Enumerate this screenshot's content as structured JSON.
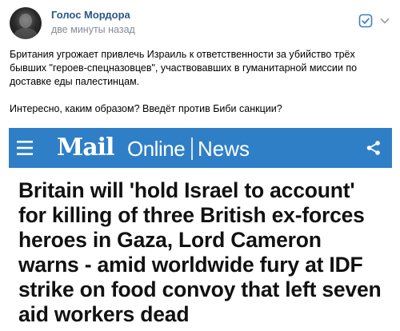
{
  "post": {
    "author": "Голос Мордора",
    "time": "две минуты назад",
    "text_paragraphs": [
      "Британия угрожает привлечь Израиль к ответственности за убийство трёх бывших \"героев-спецназовцев\", участвовавших в гуманитарной миссии по доставке еды палестинцам.",
      "Интересно, каким образом? Введёт против Биби санкции?"
    ],
    "icons": {
      "avatar": "avatar-image",
      "action": "check-square-icon",
      "more": "chevron-down-icon"
    }
  },
  "news_card": {
    "brand_mail": "Mail",
    "brand_online": "Online",
    "section": "News",
    "headline": "Britain will 'hold Israel to account' for killing of three British ex-forces heroes in Gaza, Lord Cameron warns - amid worldwide fury at IDF strike on food convoy that left seven aid workers dead",
    "colors": {
      "bar": "#2f7fc7",
      "text": "#ffffff"
    },
    "icons": {
      "menu": "hamburger-menu-icon",
      "share": "share-icon"
    }
  }
}
